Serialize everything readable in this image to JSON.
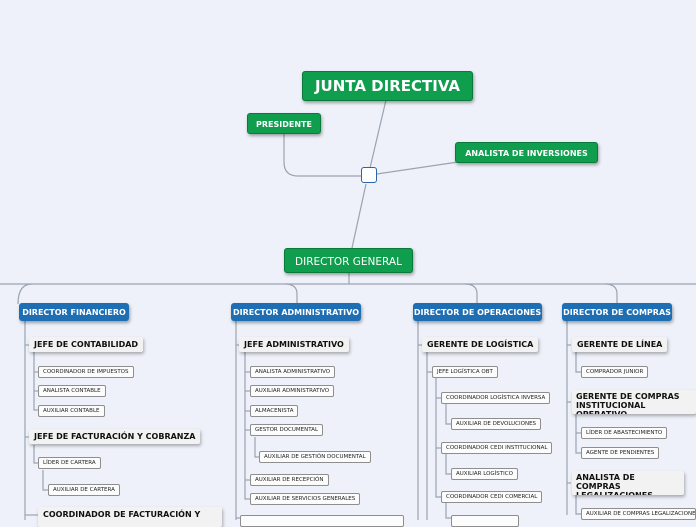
{
  "top": {
    "board": "JUNTA DIRECTIVA",
    "president": "PRESIDENTE",
    "investment_analyst": "ANALISTA DE INVERSIONES",
    "general_director": "DIRECTOR GENERAL"
  },
  "directors": [
    {
      "label": "DIRECTOR FINANCIERO",
      "children": [
        {
          "label": "JEFE DE CONTABILIDAD",
          "style": "bold"
        },
        {
          "label": "COORDINADOR DE IMPUESTOS",
          "style": "small"
        },
        {
          "label": "ANALISTA CONTABLE",
          "style": "small"
        },
        {
          "label": "AUXILIAR CONTABLE",
          "style": "small"
        },
        {
          "label": "JEFE DE FACTURACIÓN Y COBRANZA",
          "style": "bold"
        },
        {
          "label": "LÍDER DE CARTERA",
          "style": "small"
        },
        {
          "label": "AUXILIAR DE CARTERA",
          "style": "small"
        },
        {
          "label": "COORDINADOR DE FACTURACIÓN Y",
          "style": "bold"
        }
      ]
    },
    {
      "label": "DIRECTOR ADMINISTRATIVO",
      "children": [
        {
          "label": "JEFE ADMINISTRATIVO",
          "style": "bold"
        },
        {
          "label": "ANALISTA ADMINISTRATIVO",
          "style": "small"
        },
        {
          "label": "AUXILIAR ADMINISTRATIVO",
          "style": "small"
        },
        {
          "label": "ALMACENISTA",
          "style": "small"
        },
        {
          "label": "GESTOR DOCUMENTAL",
          "style": "small"
        },
        {
          "label": "AUXILIAR DE GESTIÓN DOCUMENTAL",
          "style": "small"
        },
        {
          "label": "AUXILIAR DE RECEPCIÓN",
          "style": "small"
        },
        {
          "label": "AUXILIAR DE SERVICIOS GENERALES",
          "style": "small"
        }
      ]
    },
    {
      "label": "DIRECTOR DE OPERACIONES",
      "children": [
        {
          "label": "GERENTE DE LOGÍSTICA",
          "style": "bold"
        },
        {
          "label": "JEFE LOGÍSTICA OBT",
          "style": "small"
        },
        {
          "label": "COORDINADOR LOGÍSTICA INVERSA",
          "style": "small"
        },
        {
          "label": "AUXILIAR DE DEVOLUCIONES",
          "style": "small"
        },
        {
          "label": "COORDINADOR CEDI INSTITUCIONAL",
          "style": "small"
        },
        {
          "label": "AUXILIAR LOGÍSTICO",
          "style": "small"
        },
        {
          "label": "COORDINADOR CEDI COMERCIAL",
          "style": "small"
        }
      ]
    },
    {
      "label": "DIRECTOR DE COMPRAS",
      "children": [
        {
          "label": "GERENTE DE LÍNEA",
          "style": "bold"
        },
        {
          "label": "COMPRADOR JUNIOR",
          "style": "small"
        },
        {
          "label": "GERENTE DE COMPRAS INSTITUCIONAL OPERATIVO",
          "style": "bold"
        },
        {
          "label": "LÍDER DE ABASTECIMIENTO",
          "style": "small"
        },
        {
          "label": "AGENTE DE PENDIENTES",
          "style": "small"
        },
        {
          "label": "ANALISTA DE COMPRAS LEGALIZACIONES",
          "style": "bold"
        },
        {
          "label": "AUXILIAR DE COMPRAS LEGALIZACIONES",
          "style": "small"
        }
      ]
    }
  ]
}
